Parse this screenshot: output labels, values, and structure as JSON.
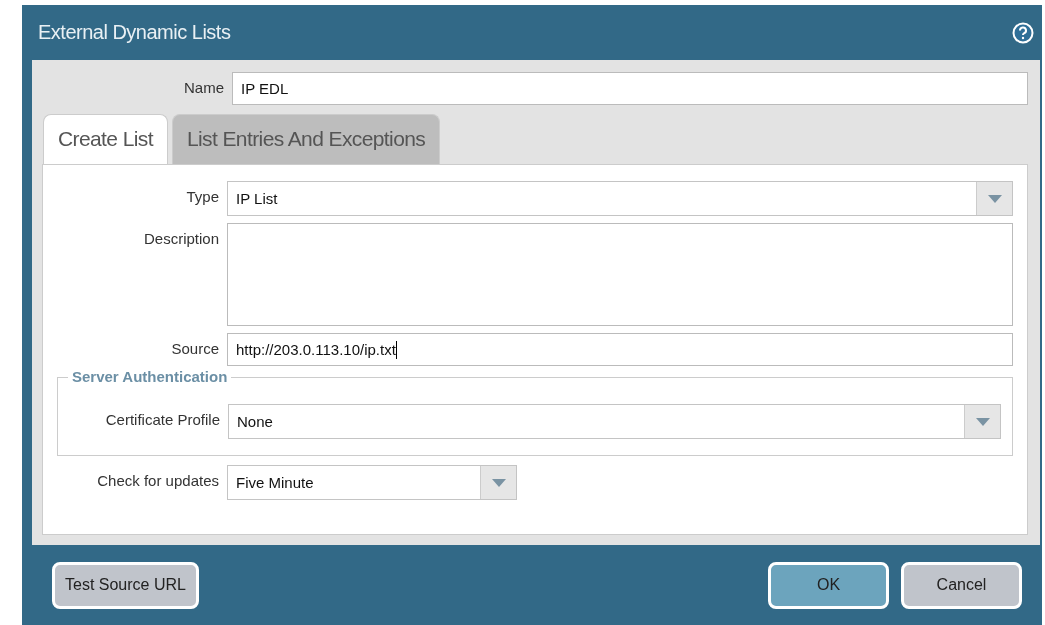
{
  "dialog": {
    "title": "External Dynamic Lists",
    "name": {
      "label": "Name",
      "value": "IP EDL"
    },
    "tabs": [
      {
        "label": "Create List",
        "selected": true
      },
      {
        "label": "List Entries And Exceptions",
        "selected": false
      }
    ],
    "fields": [
      {
        "kind": "select",
        "label": "Type",
        "value": "IP List"
      },
      {
        "kind": "textarea",
        "label": "Description"
      },
      {
        "kind": "text",
        "label": "Source",
        "value": "http://203.0.113.10/ip.txt",
        "focused": true
      }
    ],
    "fieldset": {
      "legend": "Server Authentication",
      "fields": [
        {
          "kind": "select",
          "label": "Certificate Profile",
          "value": "None"
        }
      ]
    },
    "after_fields": [
      {
        "kind": "compact-select",
        "label": "Check for updates",
        "value": "Five Minute"
      }
    ],
    "footer": {
      "left": [
        {
          "label": "Test Source URL",
          "kind": "secondary"
        }
      ],
      "right": [
        {
          "label": "OK",
          "kind": "primary"
        },
        {
          "label": "Cancel",
          "kind": "secondary"
        }
      ]
    }
  }
}
